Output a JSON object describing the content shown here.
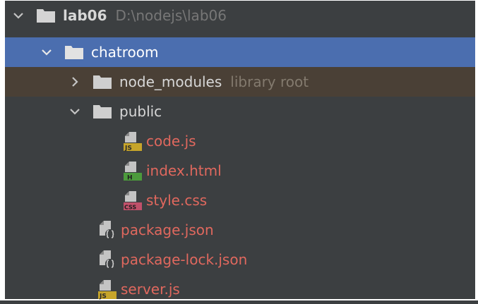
{
  "tree": {
    "root": {
      "name": "lab06",
      "path": "D:\\nodejs\\lab06"
    },
    "chatroom": {
      "name": "chatroom"
    },
    "node_modules": {
      "name": "node_modules",
      "hint": "library root"
    },
    "public": {
      "name": "public",
      "files": [
        {
          "name": "code.js",
          "badge": "JS"
        },
        {
          "name": "index.html",
          "badge": "H"
        },
        {
          "name": "style.css",
          "badge": "CSS"
        }
      ]
    },
    "files": [
      {
        "name": "package.json"
      },
      {
        "name": "package-lock.json"
      },
      {
        "name": "server.js",
        "badge": "JS"
      }
    ]
  },
  "colors": {
    "selection": "#4b6eaf",
    "excluded": "#4a4036",
    "modified_text": "#e0685e",
    "js_badge": "#c7a52a",
    "html_badge": "#4c9a3c",
    "css_badge": "#c0506a"
  }
}
